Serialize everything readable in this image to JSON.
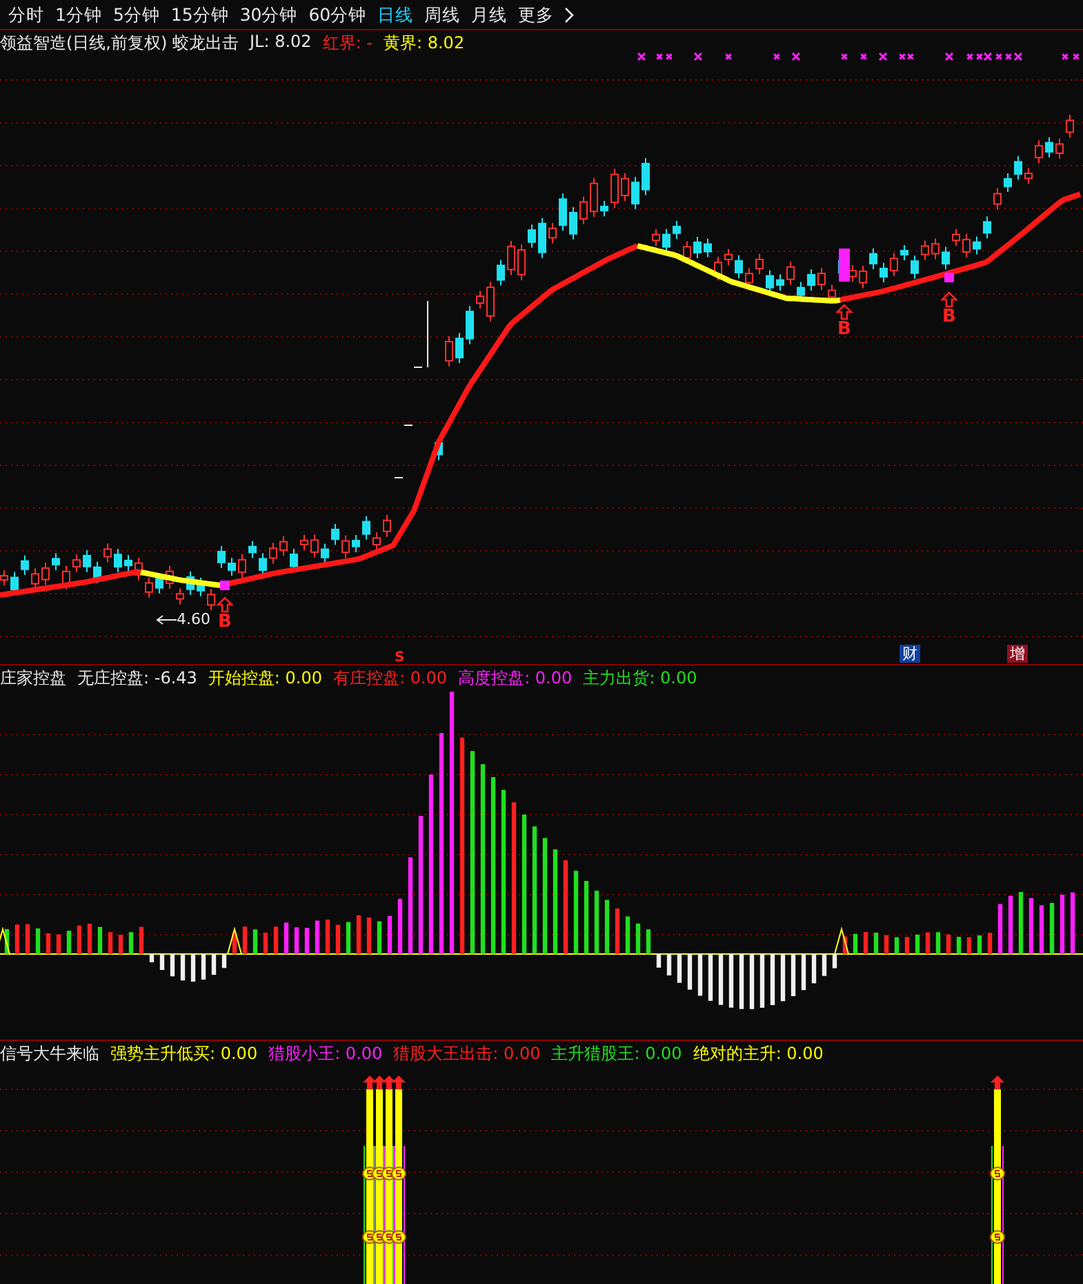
{
  "toolbar": {
    "tabs": [
      {
        "label": "分时",
        "selected": false
      },
      {
        "label": "1分钟",
        "selected": false
      },
      {
        "label": "5分钟",
        "selected": false
      },
      {
        "label": "15分钟",
        "selected": false
      },
      {
        "label": "30分钟",
        "selected": false
      },
      {
        "label": "60分钟",
        "selected": false
      },
      {
        "label": "日线",
        "selected": true
      },
      {
        "label": "周线",
        "selected": false
      },
      {
        "label": "月线",
        "selected": false
      }
    ],
    "more": "更多"
  },
  "main_chart": {
    "title": "领益智造(日线,前复权) 蛟龙出击",
    "legend": [
      {
        "text": "JL: 8.02",
        "color": "#e8e8e8"
      },
      {
        "text": "红界: -",
        "color": "#ff2020"
      },
      {
        "text": "黄界: 8.02",
        "color": "#ffff00"
      }
    ],
    "signals": [
      {
        "kind": "buy",
        "label": "B"
      },
      {
        "kind": "buy",
        "label": "B"
      },
      {
        "kind": "buy",
        "label": "B"
      }
    ],
    "low_label": "4.60",
    "markers": [
      {
        "kind": "text",
        "label": "S",
        "color": "#ff2020"
      },
      {
        "kind": "tag",
        "label": "财",
        "color": "#1040a0"
      },
      {
        "kind": "tag",
        "label": "增",
        "color": "#901020"
      }
    ]
  },
  "control_panel": {
    "title": "庄家控盘",
    "legend": [
      {
        "text": "无庄控盘: -6.43",
        "color": "#e8e8e8"
      },
      {
        "text": "开始控盘: 0.00",
        "color": "#ffff00"
      },
      {
        "text": "有庄控盘: 0.00",
        "color": "#ff2020"
      },
      {
        "text": "高度控盘: 0.00",
        "color": "#ff20ff"
      },
      {
        "text": "主力出货: 0.00",
        "color": "#20e020"
      }
    ]
  },
  "signal_panel": {
    "title": "信号大牛来临",
    "legend": [
      {
        "text": "强势主升低买: 0.00",
        "color": "#ffff00"
      },
      {
        "text": "猎股小王: 0.00",
        "color": "#ff20ff"
      },
      {
        "text": "猎股大王出击: 0.00",
        "color": "#ff2020"
      },
      {
        "text": "主升猎股王: 0.00",
        "color": "#20e020"
      },
      {
        "text": "绝对的主升: 0.00",
        "color": "#ffff00"
      }
    ]
  }
}
